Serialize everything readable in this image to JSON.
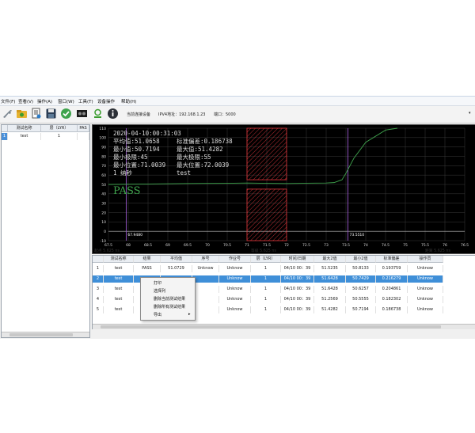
{
  "menu": [
    "文件(F)",
    "查看(V)",
    "操作(A)",
    "窗口(W)",
    "工具(T)",
    "设备操作",
    "帮助(H)"
  ],
  "toolbar": {
    "icons": [
      "wrench-icon",
      "folder-icon",
      "document-icon",
      "save-icon",
      "check-icon",
      "tape-icon",
      "person-icon",
      "info-icon"
    ],
    "current_device_label": "当前连接设备",
    "ip_label": "IPV4地址：192.168.1.23",
    "port_label": "端口：5000",
    "accent_green": "#3a9c2e",
    "dropdown_arrow": "▾"
  },
  "left_grid": {
    "headers": [
      "测试名称",
      "层（LYR）",
      "PAS"
    ],
    "row_marker": "1",
    "row": [
      "test",
      "1",
      ""
    ]
  },
  "chart_data": {
    "type": "line",
    "info_lines": [
      [
        "2020-04-10:00:31:03",
        ""
      ],
      [
        "平均值:51.0658",
        "标准偏差:0.186738"
      ],
      [
        "最小值:50.7194",
        "最大值:51.4282"
      ],
      [
        "最小极限:45",
        "最大极限:55"
      ],
      [
        "最小位置:71.0039",
        "最大位置:72.0039"
      ],
      [
        "1 纳秒",
        "test"
      ]
    ],
    "status": "PASS",
    "y_ticks": [
      110,
      100,
      90,
      80,
      70,
      60,
      50,
      40,
      30,
      20,
      10,
      0,
      -10
    ],
    "x_ticks": [
      "67.5",
      "68",
      "68.5",
      "69",
      "69.5",
      "70",
      "70.5",
      "71",
      "71.5",
      "72",
      "72.5",
      "73",
      "73.5",
      "74",
      "74.5",
      "75",
      "75.5",
      "76",
      "76.5"
    ],
    "xlim": [
      67.5,
      76.5
    ],
    "ylim": [
      -10,
      110
    ],
    "marker_left_value": "67.9480",
    "marker_right_value": "73.5510",
    "trace": {
      "x": [
        67.5,
        68.5,
        69.5,
        70.5,
        71,
        71.5,
        72,
        72.5,
        73,
        73.2,
        73.4,
        73.5,
        73.7,
        74,
        74.5,
        74.8
      ],
      "y": [
        50,
        50.5,
        51,
        51.2,
        51.5,
        51.2,
        51,
        51.3,
        51.5,
        52,
        55,
        62,
        78,
        95,
        108,
        110
      ]
    },
    "footer_left": "起点 5.625 ns",
    "footer_mid": "等级 5.625 ns",
    "footer_right": "距离 5.625 ns",
    "colors": {
      "trace": "#3fa34d",
      "grid": "#3b3b3b",
      "axis": "#bbbbbb",
      "limit": "#e8383d",
      "marker": "#9b59d0",
      "text": "#dddddd"
    }
  },
  "table": {
    "headers": [
      "测试名称",
      "结果",
      "平均值",
      "序号",
      "作业号",
      "层（LYR）",
      "时间/日期",
      "最大2值",
      "最小2值",
      "标准偏差",
      "操作员"
    ],
    "rows": [
      [
        "1",
        "test",
        "PASS",
        "51.0729",
        "Unknow",
        "Unknow",
        "1",
        "04/10 00：39",
        "51.5235",
        "50.8133",
        "0.193759",
        "Unknow"
      ],
      [
        "2",
        "test",
        "",
        "",
        "",
        "Unknow",
        "1",
        "04/10 00：39",
        "51.6428",
        "50.7429",
        "0.216279",
        "Unknow"
      ],
      [
        "3",
        "test",
        "",
        "",
        "",
        "Unknow",
        "1",
        "04/10 00：39",
        "51.6428",
        "50.6257",
        "0.204861",
        "Unknow"
      ],
      [
        "4",
        "test",
        "",
        "",
        "",
        "Unknow",
        "1",
        "04/10 00：39",
        "51.2569",
        "50.5555",
        "0.182302",
        "Unknow"
      ],
      [
        "5",
        "test",
        "",
        "",
        "",
        "Unknow",
        "1",
        "04/10 00：39",
        "51.4282",
        "50.7194",
        "0.186738",
        "Unknow"
      ]
    ],
    "selected_row": 2
  },
  "context_menu": [
    "打印",
    "选择列",
    "删除当前测试结果",
    "删除所有测试结果",
    "导出"
  ],
  "submenu_arrow": "▸"
}
